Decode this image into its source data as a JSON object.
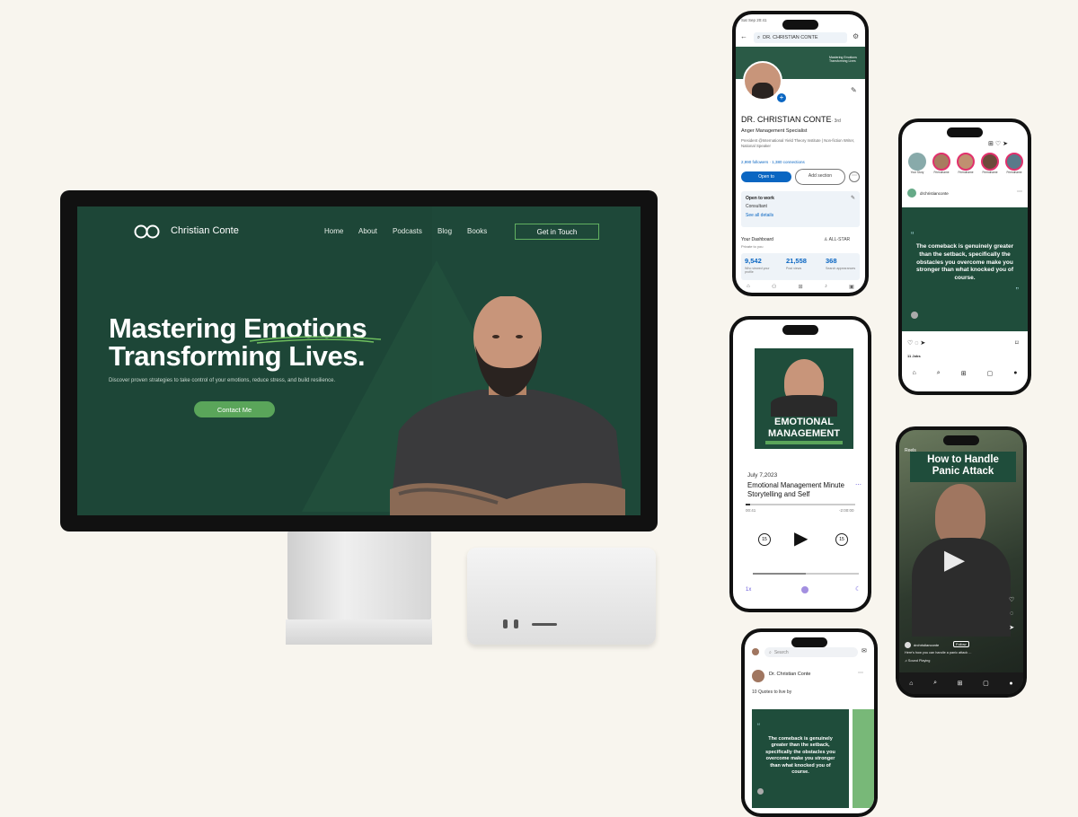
{
  "website": {
    "brand": "Christian Conte",
    "nav": [
      "Home",
      "About",
      "Podcasts",
      "Blog",
      "Books"
    ],
    "cta": "Get in Touch",
    "hero_line1": "Mastering Emotions",
    "hero_line2": "Transforming Lives.",
    "hero_sub": "Discover proven strategies to take control of your emotions, reduce stress, and build resilience.",
    "contact_button": "Contact Me"
  },
  "linkedin": {
    "status_time": "Sat Sep 20:41",
    "search_text": "DR. CHRISTIAN CONTE",
    "banner_text": "Mastering Emotions Transforming Lives",
    "name": "DR. CHRISTIAN CONTE",
    "degree": "· 3rd",
    "headline": "Anger Management Specialist",
    "bio": "President @International Yield Theory Institute | Non-fiction Writer, National Speaker",
    "followers": "2,990 followers · 1,380 connections",
    "open_to": "Open to",
    "add_section": "Add section",
    "open_to_work_title": "Open to work",
    "open_to_work_role": "Consultant",
    "see_all": "See all details",
    "dashboard_title": "Your Dashboard",
    "dashboard_sub": "Private to you",
    "all_star": "ALL-STAR",
    "stats": [
      {
        "value": "9,542",
        "label": "Who viewed your profile"
      },
      {
        "value": "21,558",
        "label": "Post views"
      },
      {
        "value": "368",
        "label": "Search appearances"
      }
    ]
  },
  "instagram": {
    "stories": [
      "Your Story",
      "Friendname",
      "Friendname",
      "Friendname",
      "Friendname"
    ],
    "handle": "drchristianconte",
    "quote": "The comeback is genuinely greater than the setback, specifically the obstacles you overcome make you stronger than what knocked you of course.",
    "likes": "11 Jobs"
  },
  "podcast": {
    "cover_line1": "EMOTIONAL",
    "cover_line2": "MANAGEMENT",
    "date": "July 7,2023",
    "title": "Emotional Management Minute Storytelling and Self",
    "time_elapsed": "00:41",
    "time_remaining": "-2:00:00",
    "speed": "1x"
  },
  "tiktok": {
    "label": "Reels",
    "title_line1": "How to Handle",
    "title_line2": "Panic Attack",
    "handle": "drchristianconte",
    "follow": "Follow",
    "caption": "Here's how you can handle a panic attack ...",
    "audio": "Sound Playing"
  },
  "facebook": {
    "search_placeholder": "Search",
    "name": "Dr. Christian Conte",
    "caption": "10 Quotes to live by",
    "quote": "The comeback is genuinely greater than the setback, specifically the obstacles you overcome make you stronger than what knocked you of course."
  },
  "colors": {
    "background": "#f8f5ee",
    "brand_green": "#1d4637",
    "accent_green": "#5aa55a",
    "linkedin_blue": "#0a66c2"
  }
}
